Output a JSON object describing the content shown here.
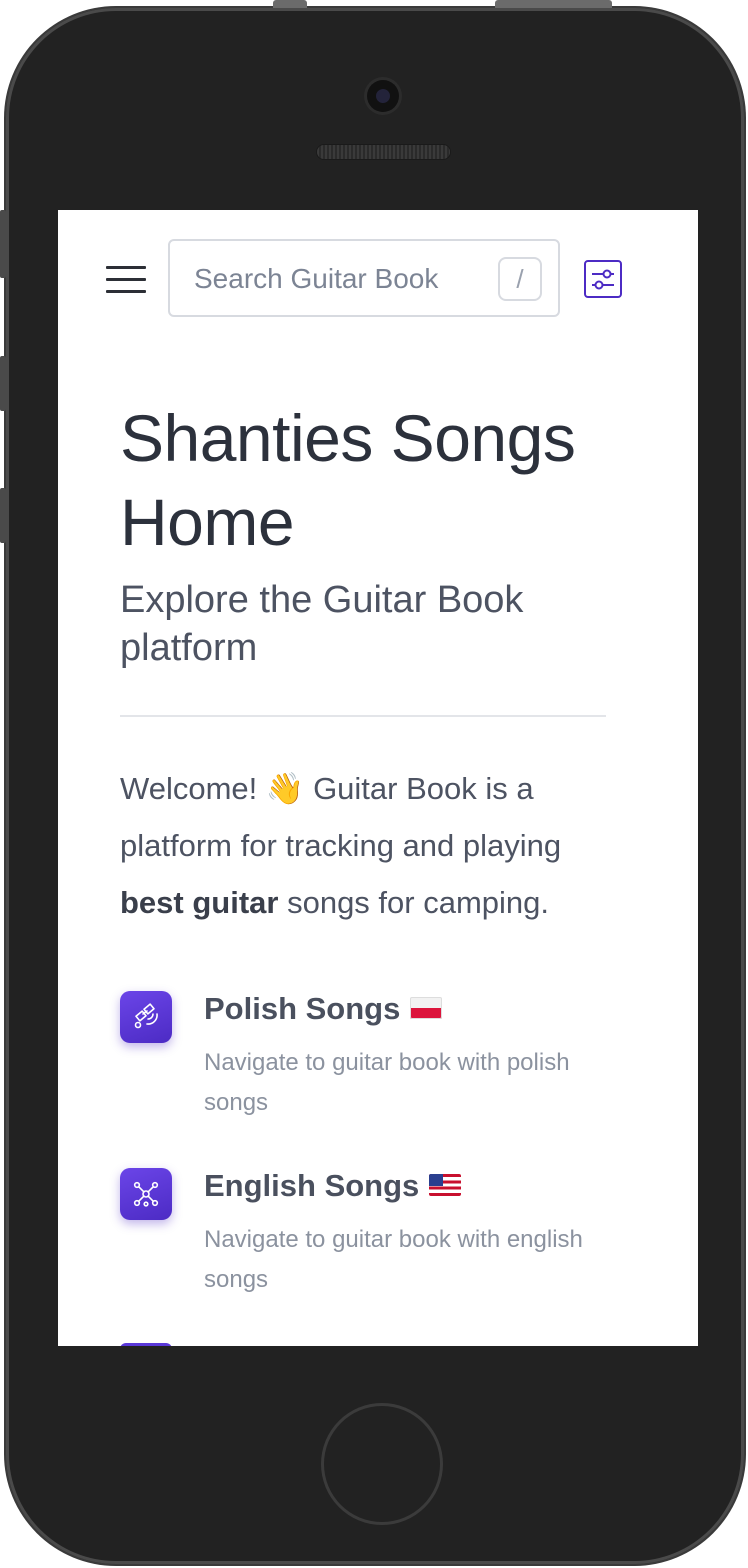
{
  "search": {
    "placeholder": "Search Guitar Book",
    "shortcut": "/"
  },
  "page": {
    "title": "Shanties Songs Home",
    "subtitle": "Explore the Guitar Book platform",
    "welcome_pre": "Welcome! 👋 Guitar Book is a platform for tracking and playing ",
    "welcome_bold": "best guitar",
    "welcome_post": " songs for camping."
  },
  "features": [
    {
      "title": "Polish Songs",
      "flag": "poland-flag",
      "icon": "satellite-icon",
      "description": "Navigate to guitar book with polish songs"
    },
    {
      "title": "English Songs",
      "flag": "usa-flag",
      "icon": "network-icon",
      "description": "Navigate to guitar book with english songs"
    }
  ],
  "colors": {
    "accent": "#4c2bc4",
    "title_text": "#2c313c",
    "body_text": "#4d5362",
    "muted_text": "#8b929f"
  }
}
